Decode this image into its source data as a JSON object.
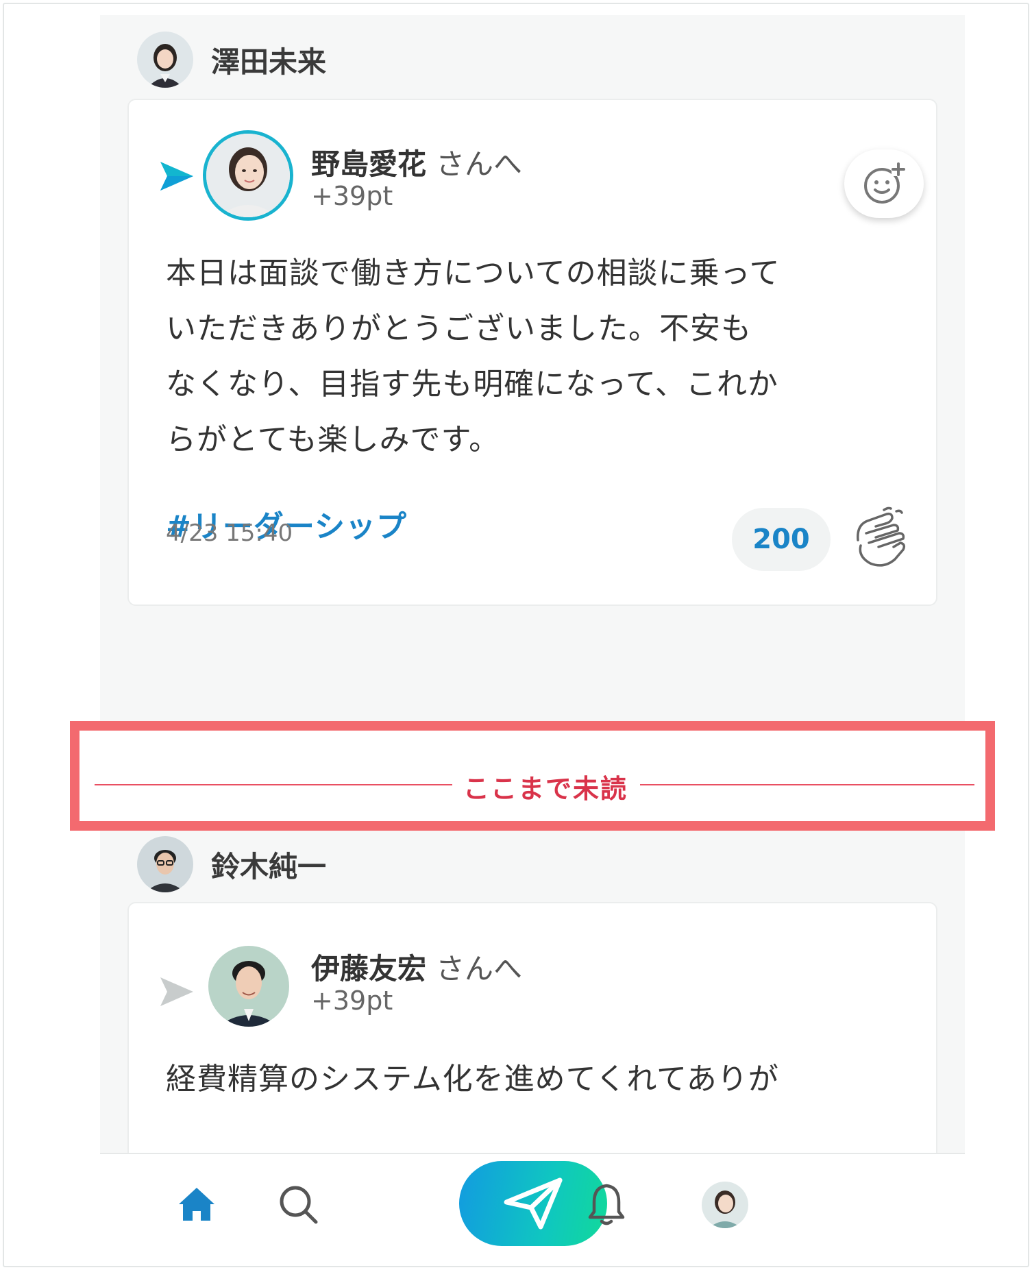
{
  "feed": {
    "post1": {
      "sender_name": "澤田未来",
      "recipient_name": "野島愛花",
      "honorific": "さんへ",
      "points": "+39pt",
      "body_lines": [
        "本日は面談で働き方についての相談に乗って",
        "いただきありがとうございました。不安も",
        "なくなり、目指す先も明確になって、これか",
        "らがとても楽しみです。"
      ],
      "hashtag": "#リーダーシップ",
      "timestamp": "4/23 15:40",
      "clap_count": "200"
    },
    "unread_divider": {
      "label": "ここまで未読"
    },
    "post2": {
      "sender_name": "鈴木純一",
      "recipient_name": "伊藤友宏",
      "honorific": "さんへ",
      "points": "+39pt",
      "body_lines": [
        "経費精算のシステム化を進めてくれてありが"
      ]
    }
  },
  "colors": {
    "accent_blue": "#1a84c7",
    "unread_red": "#d9334a",
    "highlight_border": "#f36a6f",
    "send_gradient_start": "#129be0",
    "send_gradient_end": "#12d99a"
  },
  "icons": {
    "nav": [
      "home-icon",
      "search-icon",
      "send-icon",
      "bell-icon",
      "profile-avatar"
    ],
    "card": [
      "send-arrow-icon",
      "add-reaction-icon",
      "clap-icon"
    ]
  }
}
